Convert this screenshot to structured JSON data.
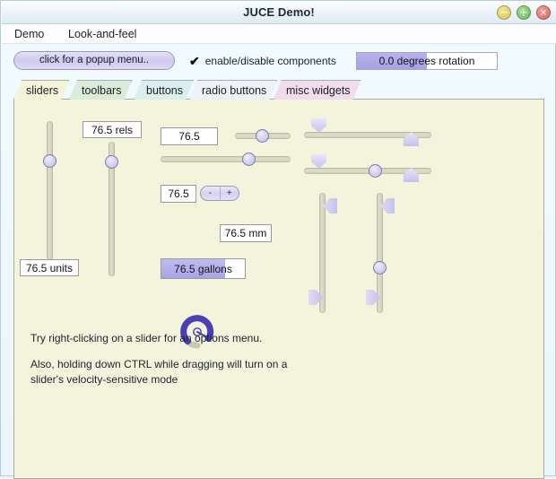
{
  "window": {
    "title": "JUCE Demo!",
    "buttons": [
      {
        "name": "minimize-button",
        "icon": "minimize-icon",
        "color": "#d8c65e"
      },
      {
        "name": "maximize-button",
        "icon": "maximize-icon",
        "color": "#6fb760"
      },
      {
        "name": "close-button",
        "icon": "close-icon",
        "color": "#d9635c"
      }
    ]
  },
  "menubar": {
    "items": [
      {
        "label": "Demo"
      },
      {
        "label": "Look-and-feel"
      }
    ]
  },
  "toolbar": {
    "popup_button_label": "click for a popup menu..",
    "checkbox": {
      "label": "enable/disable components",
      "checked": true,
      "glyph": "✔"
    },
    "rotation_slider": {
      "label": "0.0 degrees rotation",
      "value": 0.0,
      "fill_percent": 50,
      "fill_color": "#a7a1e6"
    }
  },
  "tabs": {
    "selected": "sliders",
    "items": [
      {
        "label": "sliders",
        "color": "#f4f4dd"
      },
      {
        "label": "toolbars",
        "color": "#d9ecd9"
      },
      {
        "label": "buttons",
        "color": "#dbeef0"
      },
      {
        "label": "radio buttons",
        "color": "#eef2f8"
      },
      {
        "label": "misc widgets",
        "color": "#efdcee"
      }
    ]
  },
  "panel": {
    "background": "#f4f4dd",
    "sliders": {
      "vertical_units": {
        "name": "vertical-slider-units",
        "value_label": "76.5 units",
        "value": 76.5
      },
      "vertical_rels": {
        "name": "vertical-slider-rels",
        "value_label": "76.5 rels",
        "value": 76.5
      },
      "horizontal_top": {
        "name": "horizontal-slider-with-textbox",
        "value_label": "76.5",
        "value": 76.5
      },
      "horizontal_second": {
        "name": "horizontal-slider-no-textbox",
        "value": 76.5
      },
      "incdec": {
        "name": "inc-dec-slider",
        "value_label": "76.5",
        "value": 76.5,
        "decrement_label": "-",
        "increment_label": "+"
      },
      "rotary": {
        "name": "rotary-slider",
        "value_label": "76.5 mm",
        "value": 76.5,
        "arc_color": "#4b3fb5"
      },
      "bar": {
        "name": "bar-slider-gallons",
        "value_label": "76.5 gallons",
        "value": 76.5,
        "fill_percent": 76.5,
        "fill_color": "#a9a3e6"
      },
      "two_value_h1": {
        "name": "two-value-horizontal-slider"
      },
      "three_value_h2": {
        "name": "three-value-horizontal-slider"
      },
      "two_value_v1": {
        "name": "two-value-vertical-slider"
      },
      "three_value_v2": {
        "name": "three-value-vertical-slider"
      }
    },
    "hints": [
      "Try right-clicking on a slider for an options menu.",
      "Also, holding down CTRL while dragging will turn on a",
      "slider's velocity-sensitive mode"
    ]
  }
}
